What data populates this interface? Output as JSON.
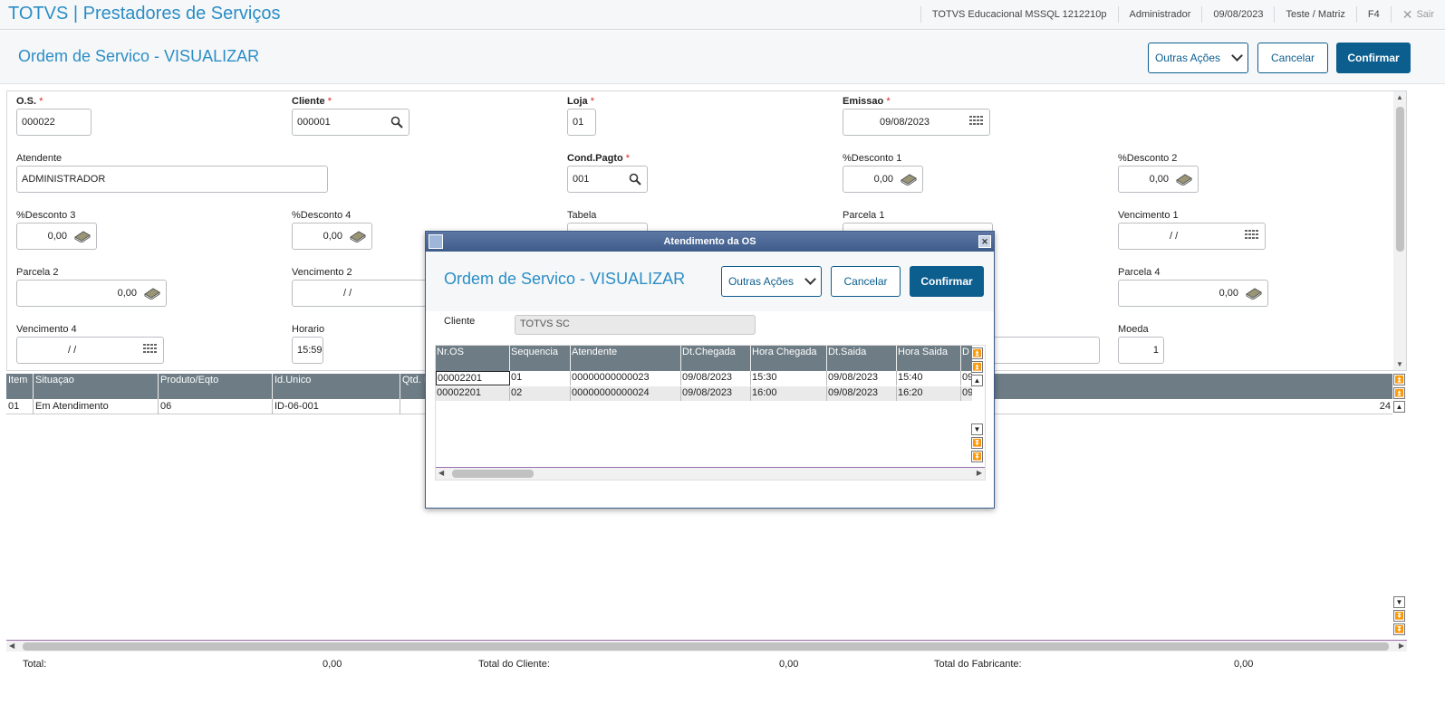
{
  "topbar": {
    "app_title": "TOTVS | Prestadores de Serviços",
    "environment": "TOTVS Educacional MSSQL 1212210p",
    "user": "Administrador",
    "date": "09/08/2023",
    "company": "Teste / Matriz",
    "shortcut": "F4",
    "exit_label": "Sair"
  },
  "page": {
    "title": "Ordem de Servico - VISUALIZAR",
    "more_actions": "Outras Ações",
    "cancel": "Cancelar",
    "confirm": "Confirmar"
  },
  "form": {
    "os": {
      "label": "O.S.",
      "value": "000022"
    },
    "cliente": {
      "label": "Cliente",
      "value": "000001"
    },
    "loja": {
      "label": "Loja",
      "value": "01"
    },
    "emissao": {
      "label": "Emissao",
      "value": "09/08/2023"
    },
    "atendente": {
      "label": "Atendente",
      "value": "ADMINISTRADOR"
    },
    "cond_pagto": {
      "label": "Cond.Pagto",
      "value": "001"
    },
    "desconto1": {
      "label": "%Desconto 1",
      "value": "0,00"
    },
    "desconto2": {
      "label": "%Desconto 2",
      "value": "0,00"
    },
    "desconto3": {
      "label": "%Desconto 3",
      "value": "0,00"
    },
    "desconto4": {
      "label": "%Desconto 4",
      "value": "0,00"
    },
    "tabela": {
      "label": "Tabela",
      "value": ""
    },
    "parcela1": {
      "label": "Parcela 1",
      "value": ""
    },
    "vencimento1": {
      "label": "Vencimento 1",
      "value": "/ /"
    },
    "parcela2": {
      "label": "Parcela 2",
      "value": "0,00"
    },
    "vencimento2": {
      "label": "Vencimento 2",
      "value": "/ /"
    },
    "parcela4": {
      "label": "Parcela 4",
      "value": "0,00"
    },
    "vencimento4": {
      "label": "Vencimento 4",
      "value": "/ /"
    },
    "horario": {
      "label": "Horario",
      "value": "15:59"
    },
    "moeda": {
      "label": "Moeda",
      "value": "1"
    }
  },
  "grid": {
    "columns": [
      "Item",
      "Situaçao",
      "Produto/Eqto",
      "Id.Unico",
      "Qtd. I"
    ],
    "rows": [
      {
        "item": "01",
        "situacao": "Em Atendimento",
        "produto": "06",
        "id_unico": "ID-06-001",
        "tail": "24"
      }
    ]
  },
  "totals": {
    "total_label": "Total:",
    "total_value": "0,00",
    "cliente_label": "Total do Cliente:",
    "cliente_value": "0,00",
    "fabricante_label": "Total do Fabricante:",
    "fabricante_value": "0,00"
  },
  "dialog": {
    "window_title": "Atendimento da OS",
    "title": "Ordem de Servico - VISUALIZAR",
    "more_actions": "Outras Ações",
    "cancel": "Cancelar",
    "confirm": "Confirmar",
    "cliente_label": "Cliente",
    "cliente_value": "TOTVS SC",
    "columns": [
      "Nr.OS",
      "Sequencia",
      "Atendente",
      "Dt.Chegada",
      "Hora Chegada",
      "Dt.Saida",
      "Hora Saida",
      "D"
    ],
    "rows": [
      [
        "00002201",
        "01",
        "00000000000023",
        "09/08/2023",
        "15:30",
        "09/08/2023",
        "15:40",
        "09"
      ],
      [
        "00002201",
        "02",
        "00000000000024",
        "09/08/2023",
        "16:00",
        "09/08/2023",
        "16:20",
        "09"
      ]
    ]
  }
}
